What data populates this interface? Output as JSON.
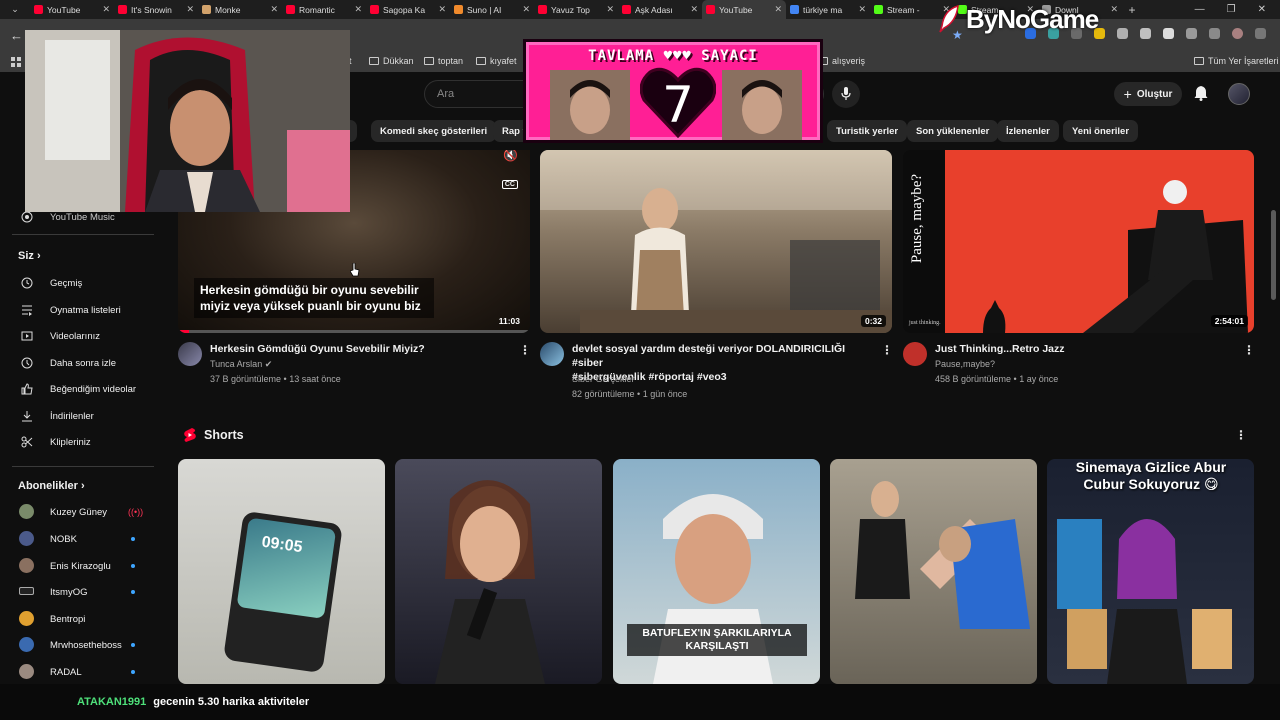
{
  "tabs": [
    {
      "title": "YouTube",
      "color": "#ff0033",
      "active": false
    },
    {
      "title": "It's Snowin",
      "color": "#ff0033",
      "active": false
    },
    {
      "title": "Monke",
      "color": "#d2a26b",
      "active": false
    },
    {
      "title": "Romantic",
      "color": "#ff0033",
      "active": false
    },
    {
      "title": "Sagopa Ka",
      "color": "#ff0033",
      "active": false
    },
    {
      "title": "Suno | AI",
      "color": "#f08a2c",
      "active": false
    },
    {
      "title": "Yavuz Top",
      "color": "#ff0033",
      "active": false
    },
    {
      "title": "Aşk Adası",
      "color": "#ff0033",
      "active": false
    },
    {
      "title": "YouTube",
      "color": "#ff0033",
      "active": true
    },
    {
      "title": "türkiye ma",
      "color": "#4285f4",
      "active": false
    },
    {
      "title": "Stream -",
      "color": "#53fc18",
      "active": false
    },
    {
      "title": "Stream",
      "color": "#53fc18",
      "active": false
    },
    {
      "title": "Downl",
      "color": "#9a9a9a",
      "active": false
    }
  ],
  "bookmarks": {
    "items": [
      "lit",
      "Dükkan",
      "toptan",
      "kıyafet",
      "alışveriş"
    ],
    "all_bookmarks": "Tüm Yer İşaretleri"
  },
  "search": {
    "placeholder": "Ara"
  },
  "masthead": {
    "create_label": "Oluştur"
  },
  "chips": [
    "er",
    "Komedi skeç gösterileri",
    "Rap yap",
    "Turistik yerler",
    "Son yüklenenler",
    "İzlenenler",
    "Yeni öneriler"
  ],
  "sidebar": {
    "top_item": "YouTube Music",
    "you_header": "Siz",
    "you_items": [
      "Geçmiş",
      "Oynatma listeleri",
      "Videolarınız",
      "Daha sonra izle",
      "Beğendiğim videolar",
      "İndirilenler",
      "Klipleriniz"
    ],
    "subs_header": "Abonelikler",
    "subs": [
      {
        "name": "Kuzey Güney",
        "live": true
      },
      {
        "name": "NOBK",
        "live": false
      },
      {
        "name": "Enis Kirazoglu",
        "live": false
      },
      {
        "name": "ItsmyOG",
        "live": false
      },
      {
        "name": "Bentropi",
        "live": false
      },
      {
        "name": "Mrwhosetheboss",
        "live": false
      },
      {
        "name": "RADAL",
        "live": false
      }
    ]
  },
  "videos": [
    {
      "title": "Herkesin Gömdüğü Oyunu Sevebilir Miyiz?",
      "channel": "Tunca Arslan",
      "verified": true,
      "meta": "37 B görüntüleme • 13 saat önce",
      "duration": "11:03",
      "caption": "Herkesin gömdüğü bir oyunu sevebilir miyiz veya yüksek puanlı bir oyunu biz",
      "cc": "CC"
    },
    {
      "title_line1": "devlet sosyal yardım desteği veriyor DOLANDIRICILIĞI #siber",
      "title_line2": "#sibergüvenlik #röportaj #veo3",
      "channel": "Siber Gerçekler",
      "meta": "82 görüntüleme • 1 gün önce",
      "duration": "0:32"
    },
    {
      "title": "Just Thinking...Retro Jazz",
      "channel": "Pause,maybe?",
      "meta": "458 B görüntüleme • 1 ay önce",
      "duration": "2:54:01",
      "thumb_text": "Pause, maybe?",
      "thumb_small": "just thinking."
    }
  ],
  "shorts": {
    "header": "Shorts",
    "items": [
      {
        "overlay": "",
        "phone_time": "09:05"
      },
      {
        "overlay": ""
      },
      {
        "overlay": "BATUFLEX'IN ŞARKILARIYLA KARŞILAŞTI"
      },
      {
        "overlay": ""
      },
      {
        "overlay": "Sinemaya Gizlice Abur Cubur Sokuyoruz 😋"
      }
    ]
  },
  "overlay_counter": {
    "title": "TAVLAMA ♥♥♥ SAYACI",
    "count": "7"
  },
  "overlay_logo": {
    "text": "ByNoGame"
  },
  "ticker": {
    "user": "ATAKAN1991",
    "message": "gecenin 5.30 harika aktiviteler"
  },
  "colors": {
    "bg": "#0f0f0f",
    "chip": "#272727",
    "accent_red": "#ff0033",
    "counter_pink": "#ff1f95",
    "ticker_user": "#4ee07a"
  }
}
